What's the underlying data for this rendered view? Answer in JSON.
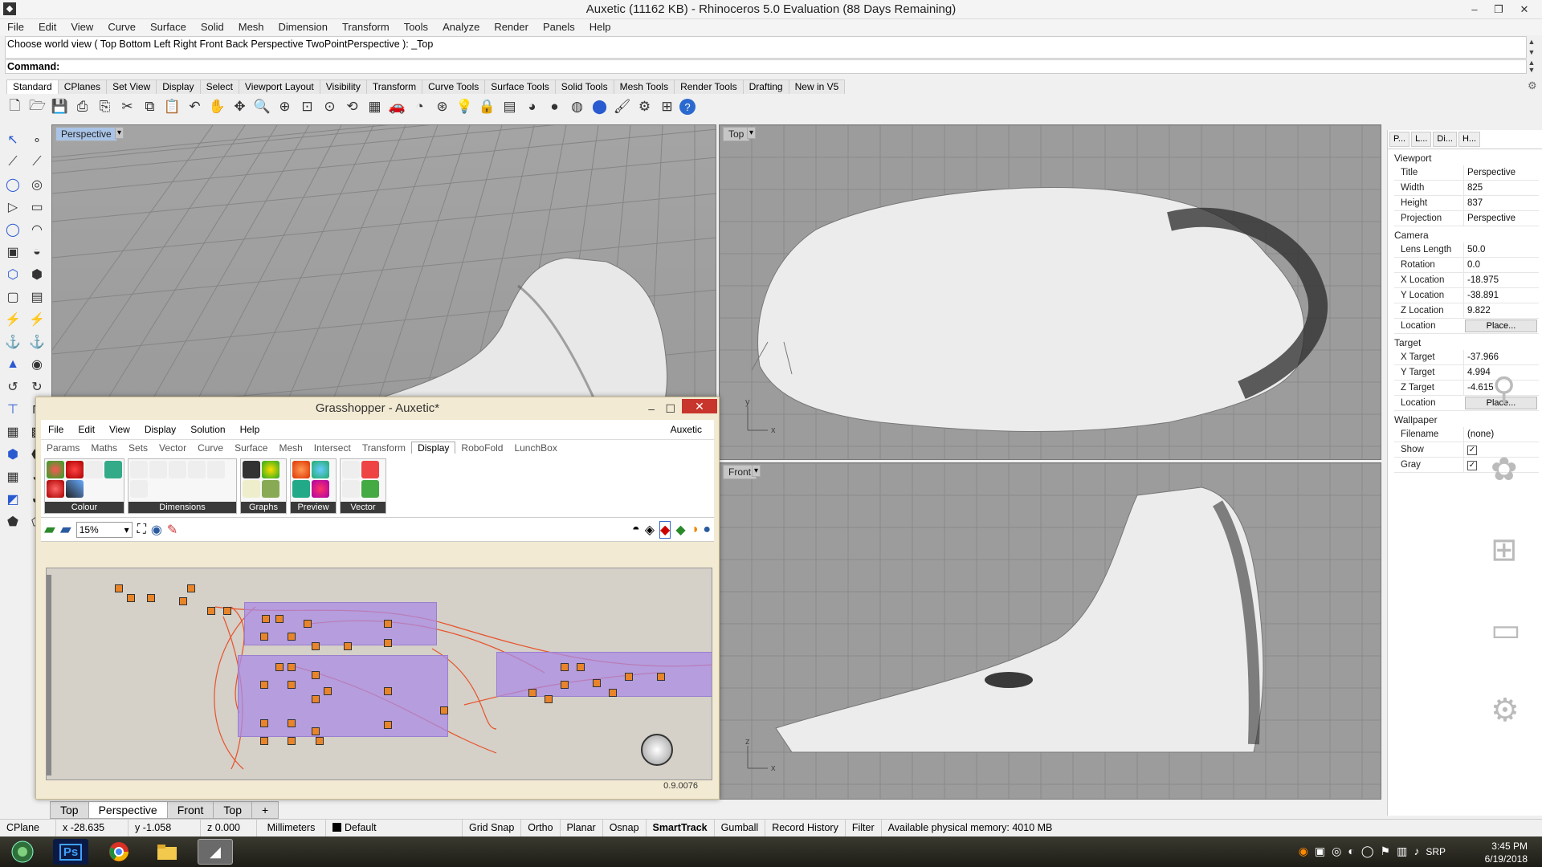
{
  "window": {
    "title": "Auxetic (11162 KB) - Rhinoceros 5.0 Evaluation (88 Days Remaining)",
    "minimize": "–",
    "restore": "❐",
    "close": "✕"
  },
  "menu": [
    "File",
    "Edit",
    "View",
    "Curve",
    "Surface",
    "Solid",
    "Mesh",
    "Dimension",
    "Transform",
    "Tools",
    "Analyze",
    "Render",
    "Panels",
    "Help"
  ],
  "command": {
    "history": "Choose world view ( Top  Bottom  Left  Right  Front  Back  Perspective  TwoPointPerspective ): _Top",
    "prompt": "Command:"
  },
  "toolbar_tabs": [
    "Standard",
    "CPlanes",
    "Set View",
    "Display",
    "Select",
    "Viewport Layout",
    "Visibility",
    "Transform",
    "Curve Tools",
    "Surface Tools",
    "Solid Tools",
    "Mesh Tools",
    "Render Tools",
    "Drafting",
    "New in V5"
  ],
  "toolbar_icons": [
    "new-file-icon",
    "open-file-icon",
    "save-icon",
    "print-icon",
    "import-icon",
    "cut-icon",
    "copy-icon",
    "paste-icon",
    "undo-icon",
    "pan-hand-icon",
    "rotate-view-icon",
    "zoom-icon",
    "zoom-window-icon",
    "zoom-extents-icon",
    "zoom-selected-icon",
    "rotate-icon",
    "four-viewports-icon",
    "car-icon",
    "camera-icon",
    "cplane-icon",
    "bulb-icon",
    "lock-icon",
    "layer-icon",
    "color-icon",
    "sphere-shaded-icon",
    "sphere-rendered-icon",
    "sphere-blue-icon",
    "brush-icon",
    "settings-gear-icon",
    "grid-snap-icon",
    "help-icon"
  ],
  "viewports": {
    "perspective": "Perspective",
    "top": "Top",
    "front": "Front",
    "axis_x": "x",
    "axis_y": "y",
    "axis_z": "z"
  },
  "panel": {
    "tabs": [
      "P...",
      "L...",
      "Di...",
      "H..."
    ],
    "viewport_header": "Viewport",
    "viewport": [
      {
        "k": "Title",
        "v": "Perspective"
      },
      {
        "k": "Width",
        "v": "825"
      },
      {
        "k": "Height",
        "v": "837"
      },
      {
        "k": "Projection",
        "v": "Perspective"
      }
    ],
    "camera_header": "Camera",
    "camera": [
      {
        "k": "Lens Length",
        "v": "50.0"
      },
      {
        "k": "Rotation",
        "v": "0.0"
      },
      {
        "k": "X Location",
        "v": "-18.975"
      },
      {
        "k": "Y Location",
        "v": "-38.891"
      },
      {
        "k": "Z Location",
        "v": "9.822"
      }
    ],
    "camera_location_label": "Location",
    "place_button": "Place...",
    "target_header": "Target",
    "target": [
      {
        "k": "X Target",
        "v": "-37.966"
      },
      {
        "k": "Y Target",
        "v": "4.994"
      },
      {
        "k": "Z Target",
        "v": "-4.615"
      }
    ],
    "target_location_label": "Location",
    "wallpaper_header": "Wallpaper",
    "filename_label": "Filename",
    "filename_value": "(none)",
    "show_label": "Show",
    "gray_label": "Gray"
  },
  "viewport_tabs": [
    "Top",
    "Perspective",
    "Front",
    "Top",
    "+"
  ],
  "status": {
    "cplane": "CPlane",
    "x": "x -28.635",
    "y": "y -1.058",
    "z": "z 0.000",
    "units": "Millimeters",
    "layer": "Default",
    "grid_snap": "Grid Snap",
    "ortho": "Ortho",
    "planar": "Planar",
    "osnap": "Osnap",
    "smarttrack": "SmartTrack",
    "gumball": "Gumball",
    "record_history": "Record History",
    "filter": "Filter",
    "memory": "Available physical memory: 4010 MB"
  },
  "taskbar": {
    "time": "3:45 PM",
    "date": "6/19/2018",
    "lang": "SRP"
  },
  "grasshopper": {
    "title": "Grasshopper - Auxetic*",
    "menu": [
      "File",
      "Edit",
      "View",
      "Display",
      "Solution",
      "Help"
    ],
    "doc_name": "Auxetic",
    "tabs": [
      "Params",
      "Maths",
      "Sets",
      "Vector",
      "Curve",
      "Surface",
      "Mesh",
      "Intersect",
      "Transform",
      "Display",
      "RoboFold",
      "LunchBox"
    ],
    "groups": [
      "Colour",
      "Dimensions",
      "Graphs",
      "Preview",
      "Vector"
    ],
    "zoom": "15%",
    "version": "0.9.0076"
  },
  "colors": {
    "accent": "#a9c4e6",
    "gh_bg": "#f2ead2",
    "gh_group": "#aa8ce6",
    "gh_node": "#e8842a",
    "close_red": "#c8352c"
  }
}
